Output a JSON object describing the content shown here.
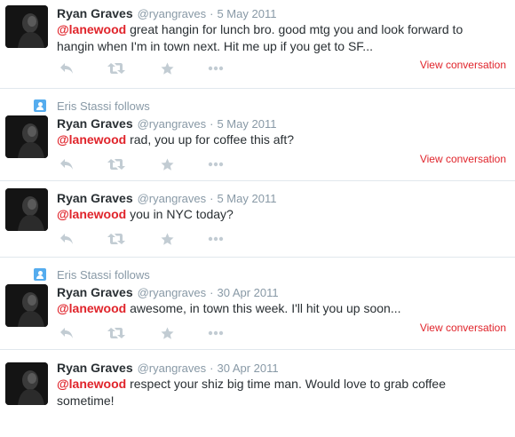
{
  "colors": {
    "accent": "#e0242b",
    "muted": "#8899a6",
    "text": "#292f33",
    "follow": "#55acee"
  },
  "tweets": [
    {
      "context": "",
      "fullname": "Ryan Graves",
      "username": "@ryangraves",
      "separator": "·",
      "time": "5 May 2011",
      "mention": "@lanewood",
      "body": " great hangin for lunch bro. good mtg you and look forward to hangin when I'm in town next. Hit me up if you get to SF...",
      "view_conversation": "View conversation"
    },
    {
      "context": "Eris Stassi follows",
      "fullname": "Ryan Graves",
      "username": "@ryangraves",
      "separator": "·",
      "time": "5 May 2011",
      "mention": "@lanewood",
      "body": " rad, you up for coffee this aft?",
      "view_conversation": "View conversation"
    },
    {
      "context": "",
      "fullname": "Ryan Graves",
      "username": "@ryangraves",
      "separator": "·",
      "time": "5 May 2011",
      "mention": "@lanewood",
      "body": " you in NYC today?",
      "view_conversation": ""
    },
    {
      "context": "Eris Stassi follows",
      "fullname": "Ryan Graves",
      "username": "@ryangraves",
      "separator": "·",
      "time": "30 Apr 2011",
      "mention": "@lanewood",
      "body": " awesome, in town this week. I'll hit you up soon...",
      "view_conversation": "View conversation"
    },
    {
      "context": "",
      "fullname": "Ryan Graves",
      "username": "@ryangraves",
      "separator": "·",
      "time": "30 Apr 2011",
      "mention": "@lanewood",
      "body": " respect your shiz big time man. Would love to grab coffee sometime!",
      "view_conversation": ""
    }
  ],
  "icons": {
    "reply": "reply-icon",
    "retweet": "retweet-icon",
    "favorite": "star-icon",
    "more": "more-icon",
    "follow": "person-follow-icon"
  }
}
